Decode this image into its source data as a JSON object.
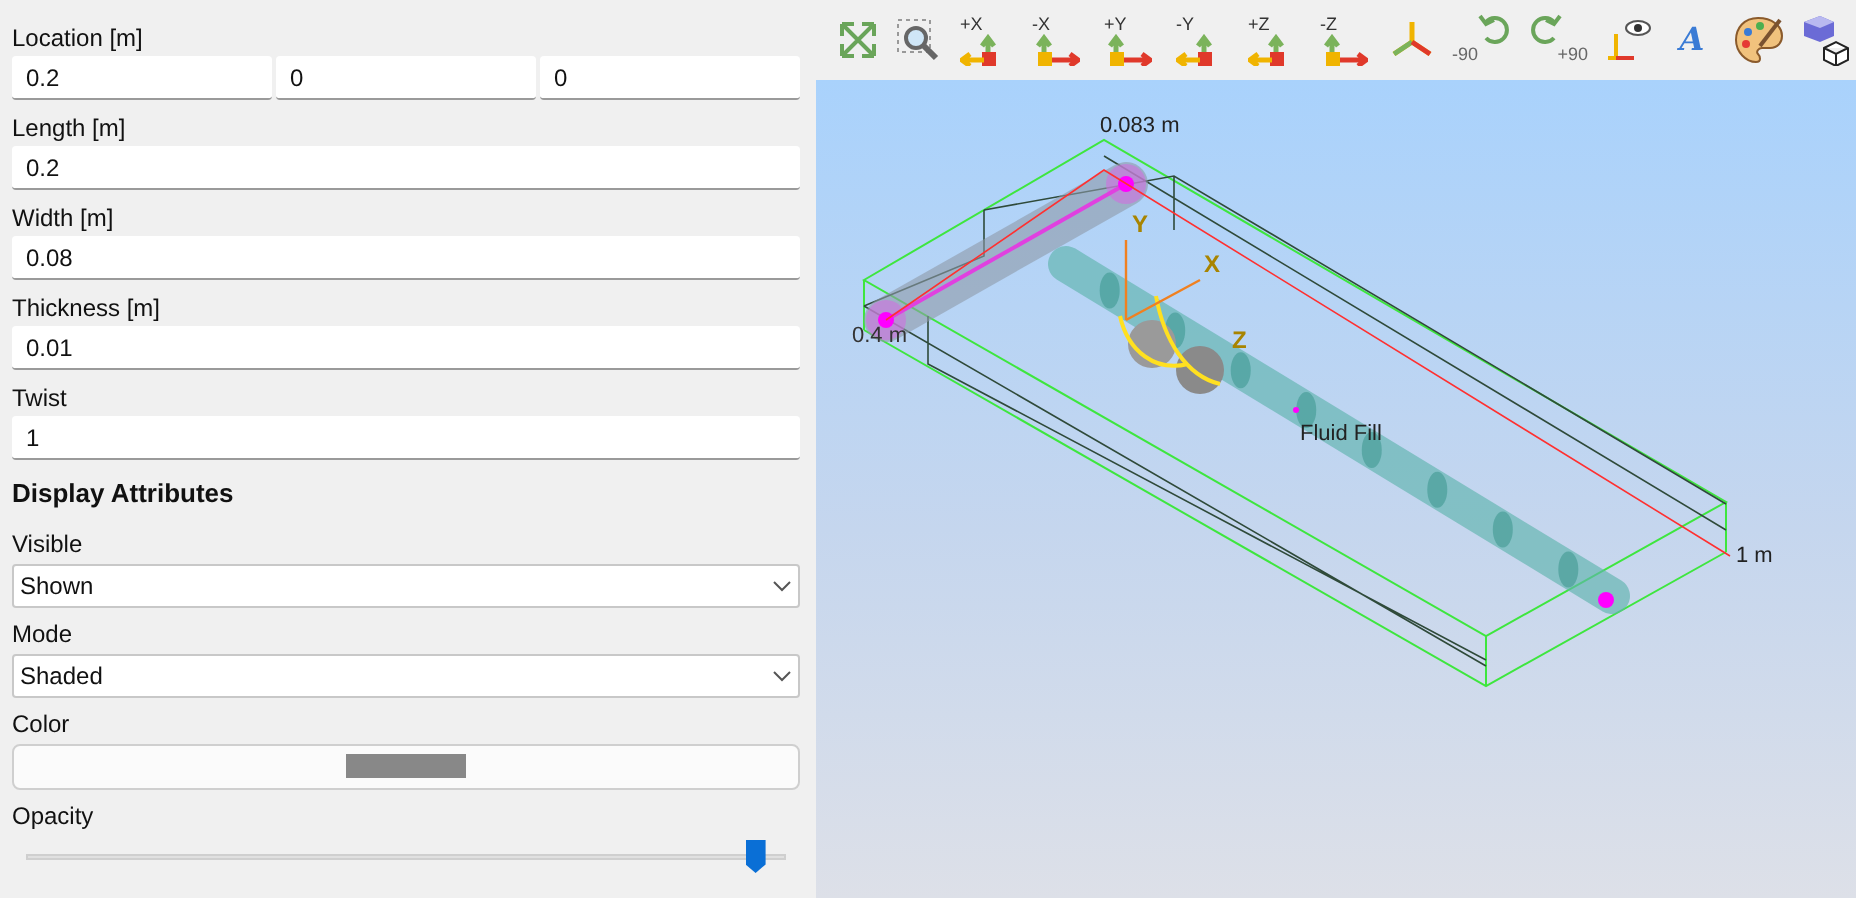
{
  "fields": [
    {
      "label": "Location [m]",
      "values": [
        "0.2",
        "0",
        "0"
      ]
    },
    {
      "label": "Length [m]",
      "values": [
        "0.2"
      ]
    },
    {
      "label": "Width [m]",
      "values": [
        "0.08"
      ]
    },
    {
      "label": "Thickness [m]",
      "values": [
        "0.01"
      ]
    },
    {
      "label": "Twist",
      "values": [
        "1"
      ]
    }
  ],
  "section_title": "Display Attributes",
  "dropdowns": [
    {
      "label": "Visible",
      "value": "Shown"
    },
    {
      "label": "Mode",
      "value": "Shaded"
    }
  ],
  "color_field": {
    "label": "Color",
    "color": "#888888"
  },
  "opacity": {
    "label": "Opacity",
    "level": 0.96
  },
  "toolbar": [
    {
      "kind": "fit"
    },
    {
      "kind": "zoom"
    },
    {
      "kind": "axisleft",
      "label": "+X"
    },
    {
      "kind": "axisright",
      "label": "-X"
    },
    {
      "kind": "axisright",
      "label": "+Y"
    },
    {
      "kind": "axisleft",
      "label": "-Y"
    },
    {
      "kind": "axisleft",
      "label": "+Z"
    },
    {
      "kind": "axisright",
      "label": "-Z"
    },
    {
      "kind": "iso"
    },
    {
      "kind": "rotateleft",
      "label": "-90"
    },
    {
      "kind": "rotateright",
      "label": "+90"
    },
    {
      "kind": "eye"
    },
    {
      "kind": "text",
      "label": "A"
    },
    {
      "kind": "palette"
    },
    {
      "kind": "cube"
    }
  ],
  "viewport": {
    "dimension_labels": [
      "0.083 m",
      "0.4 m",
      "1 m"
    ],
    "axis_labels": [
      "Y",
      "X",
      "Z"
    ],
    "object_label": "Fluid Fill"
  }
}
